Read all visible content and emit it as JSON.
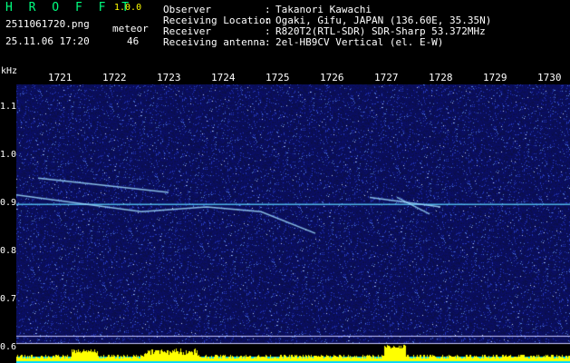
{
  "header": {
    "app_name": "H R O F F T",
    "version": "1.0.0",
    "filename": "2511061720.png",
    "datetime": "25.11.06 17:20",
    "meteor_label": "meteor",
    "meteor_count": "46"
  },
  "station": [
    {
      "label": "Observer",
      "value": "Takanori Kawachi"
    },
    {
      "label": "Receiving Location",
      "value": "Ogaki, Gifu, JAPAN (136.60E, 35.35N)"
    },
    {
      "label": "Receiver",
      "value": "R820T2(RTL-SDR) SDR-Sharp 53.372MHz"
    },
    {
      "label": "Receiving antenna",
      "value": "2el-HB9CV Vertical (el. E-W)"
    }
  ],
  "separator": ":",
  "axis": {
    "unit": "kHz",
    "time_labels": [
      "1721",
      "1722",
      "1723",
      "1724",
      "1725",
      "1726",
      "1727",
      "1728",
      "1729",
      "1730"
    ],
    "freq_labels": [
      "1.1",
      "1.0",
      "0.9",
      "0.8",
      "0.7",
      "0.6"
    ],
    "time_range": [
      1720,
      1730
    ],
    "freq_range": [
      0.57,
      1.15
    ],
    "carrier_khz": 0.9
  },
  "colors": {
    "background": "#000000",
    "noise": "#1b2a9c",
    "carrier": "#5ad0ff",
    "baseline": "#00d8ff",
    "activity": "#ffff00",
    "title": "#00ff7f",
    "text": "#ffffff"
  }
}
